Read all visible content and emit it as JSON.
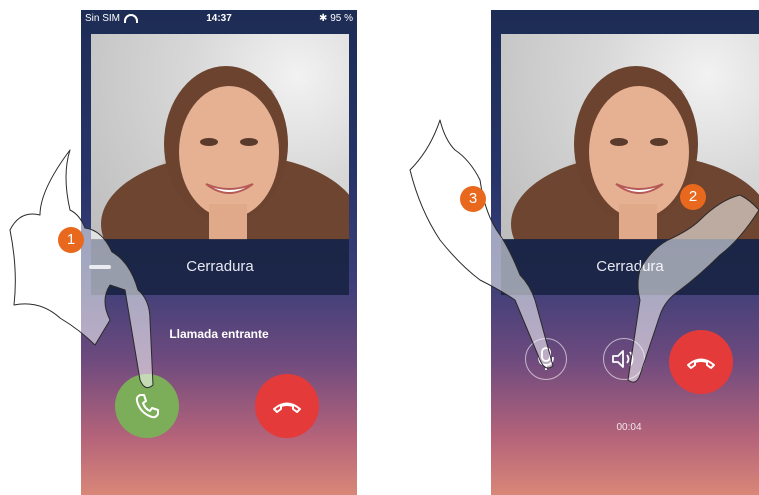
{
  "left_screen": {
    "status": {
      "carrier": "Sin SIM",
      "time": "14:37",
      "battery": "✱ 95 %"
    },
    "lock_label": "Cerradura",
    "incoming_label": "Llamada entrante"
  },
  "right_screen": {
    "lock_label": "Cerradura",
    "timer": "00:04"
  },
  "callouts": [
    "1",
    "2",
    "3"
  ],
  "colors": {
    "answer": "#7cae5a",
    "hangup": "#e43a3a",
    "callout": "#e8691e"
  },
  "icons": [
    "wifi-icon",
    "key-icon",
    "phone-answer-icon",
    "phone-hangup-icon",
    "microphone-icon",
    "speaker-icon"
  ]
}
